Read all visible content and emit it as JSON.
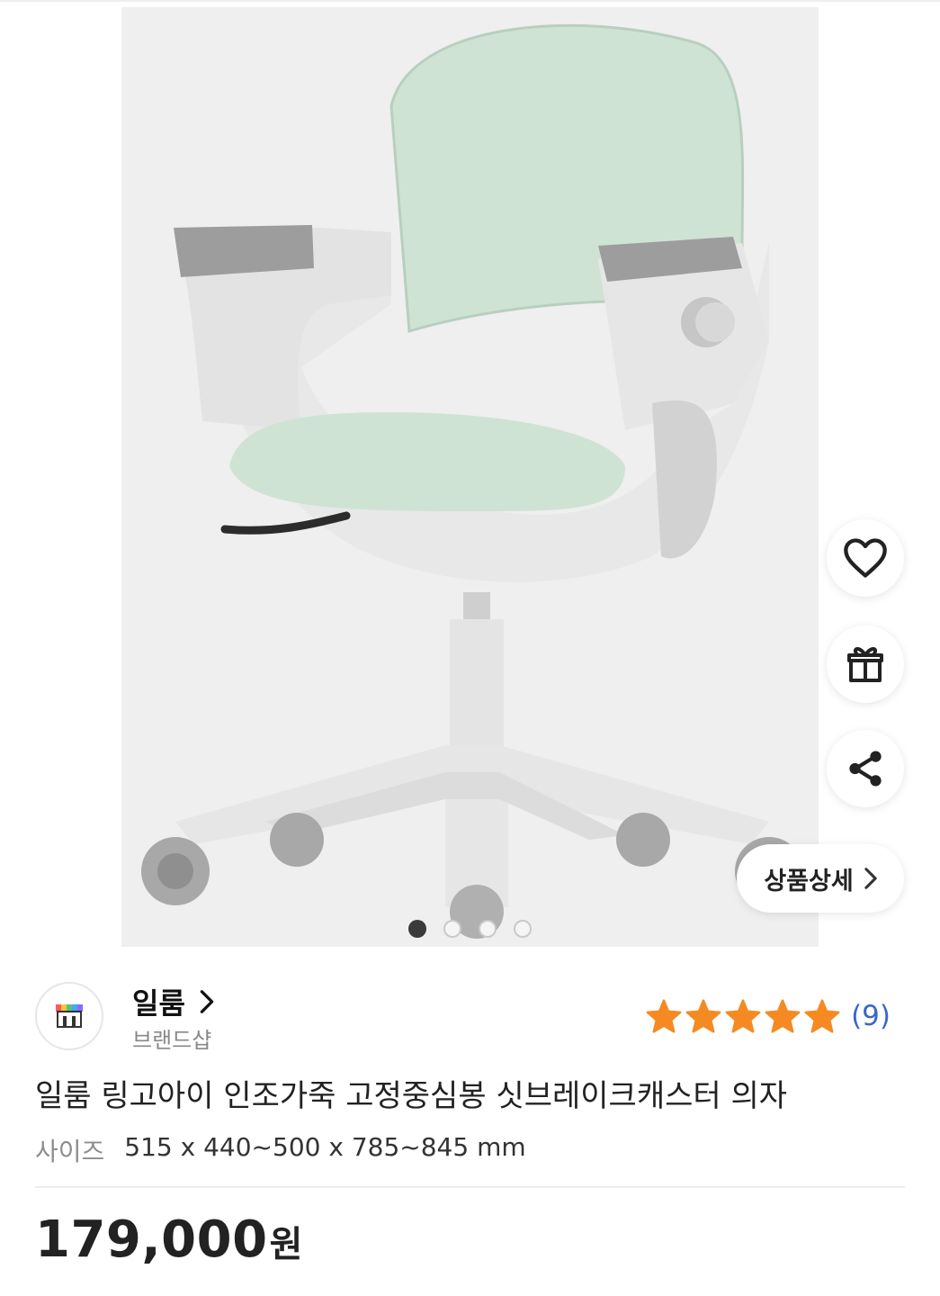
{
  "product_image": {
    "alt_icon": "chair-photo"
  },
  "carousel": {
    "count": 4,
    "active_index": 0
  },
  "actions": {
    "wishlist_icon": "heart-icon",
    "gift_icon": "gift-icon",
    "share_icon": "share-icon",
    "detail_label": "상품상세"
  },
  "brand": {
    "name": "일룸",
    "sub": "브랜드샵",
    "logo_icon": "store-icon"
  },
  "rating": {
    "stars": 5,
    "count_text": "(9)",
    "star_color": "#f58a22"
  },
  "product": {
    "title": "일룸 링고아이 인조가죽 고정중심봉 싯브레이크캐스터 의자",
    "size_label": "사이즈",
    "size_value": "515 x 440~500 x 785~845 mm",
    "price": "179,000",
    "price_unit": "원"
  }
}
